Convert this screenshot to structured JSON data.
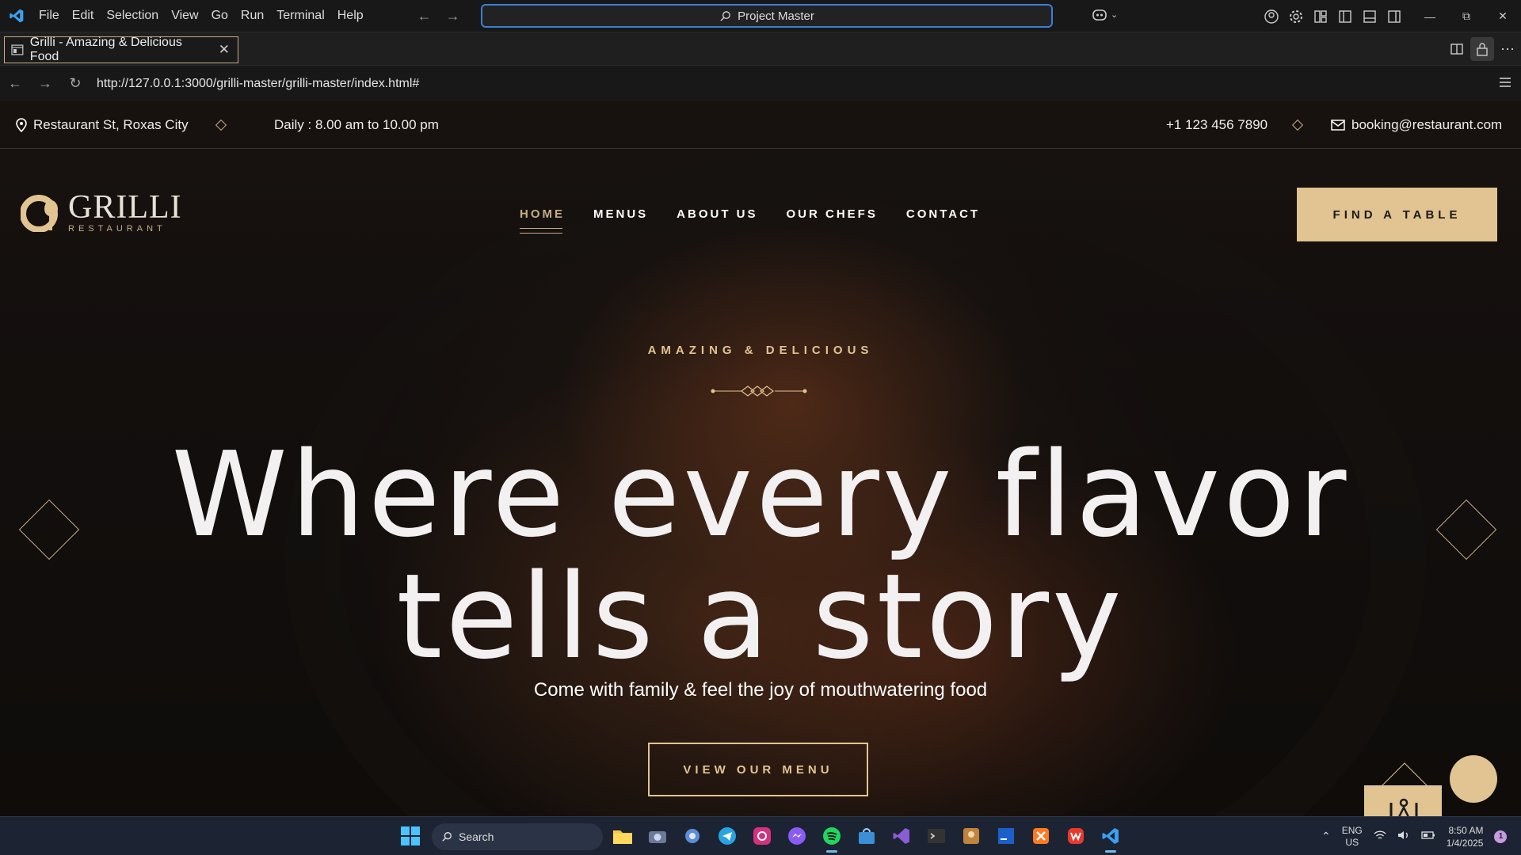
{
  "vscode": {
    "menu": [
      "File",
      "Edit",
      "Selection",
      "View",
      "Go",
      "Run",
      "Terminal",
      "Help"
    ],
    "command_center": "Project Master",
    "tab_title": "Grilli - Amazing & Delicious Food"
  },
  "browser": {
    "url": "http://127.0.0.1:3000/grilli-master/grilli-master/index.html#"
  },
  "site": {
    "topbar": {
      "address": "Restaurant St, Roxas City",
      "hours": "Daily : 8.00 am to 10.00 pm",
      "phone": "+1 123 456 7890",
      "email": "booking@restaurant.com"
    },
    "logo": {
      "name": "GRILLI",
      "sub": "RESTAURANT"
    },
    "nav": [
      "HOME",
      "MENUS",
      "ABOUT US",
      "OUR CHEFS",
      "CONTACT"
    ],
    "nav_active": "HOME",
    "find_table": "FIND A TABLE",
    "hero": {
      "eyebrow": "AMAZING & DELICIOUS",
      "headline_line1": "Where every flavor",
      "headline_line2": "tells a story",
      "subline": "Come with family & feel the joy of mouthwatering food",
      "cta": "VIEW OUR MENU"
    },
    "colors": {
      "accent": "#e1c491",
      "dark": "#1a1513"
    }
  },
  "taskbar": {
    "search_placeholder": "Search",
    "lang_1": "ENG",
    "lang_2": "US",
    "time": "8:50 AM",
    "date": "1/4/2025",
    "notification_count": "1",
    "apps": [
      "file-explorer",
      "camera",
      "settings",
      "telegram",
      "instagram",
      "messenger",
      "spotify",
      "store",
      "visual-studio",
      "terminal",
      "game",
      "ide",
      "xampp",
      "wps",
      "vscode"
    ]
  }
}
